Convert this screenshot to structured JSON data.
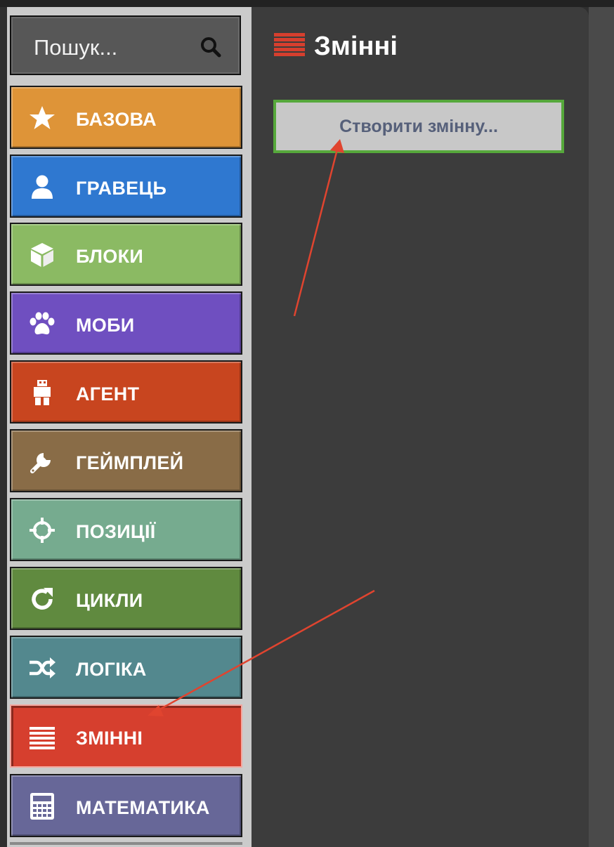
{
  "search": {
    "placeholder": "Пошук..."
  },
  "categories": [
    {
      "label": "БАЗОВА",
      "icon": "star-icon",
      "color": "#de9438"
    },
    {
      "label": "ГРАВЕЦЬ",
      "icon": "user-icon",
      "color": "#2f78d0"
    },
    {
      "label": "БЛОКИ",
      "icon": "cube-icon",
      "color": "#8bba63"
    },
    {
      "label": "МОБИ",
      "icon": "paw-icon",
      "color": "#6f4fc0"
    },
    {
      "label": "АГЕНТ",
      "icon": "agent-icon",
      "color": "#c8451f"
    },
    {
      "label": "ГЕЙМПЛЕЙ",
      "icon": "wrench-icon",
      "color": "#896c47"
    },
    {
      "label": "ПОЗИЦІЇ",
      "icon": "crosshair-icon",
      "color": "#76ab8f"
    },
    {
      "label": "ЦИКЛИ",
      "icon": "loop-icon",
      "color": "#608a3f"
    },
    {
      "label": "ЛОГІКА",
      "icon": "shuffle-icon",
      "color": "#53888e"
    },
    {
      "label": "ЗМІННІ",
      "icon": "list-icon",
      "color": "#d63f2e",
      "active": true
    },
    {
      "label": "МАТЕМАТИКА",
      "icon": "calculator-icon",
      "color": "#676798"
    }
  ],
  "flyout": {
    "title": "Змінні",
    "create_button": "Створити змінну..."
  }
}
